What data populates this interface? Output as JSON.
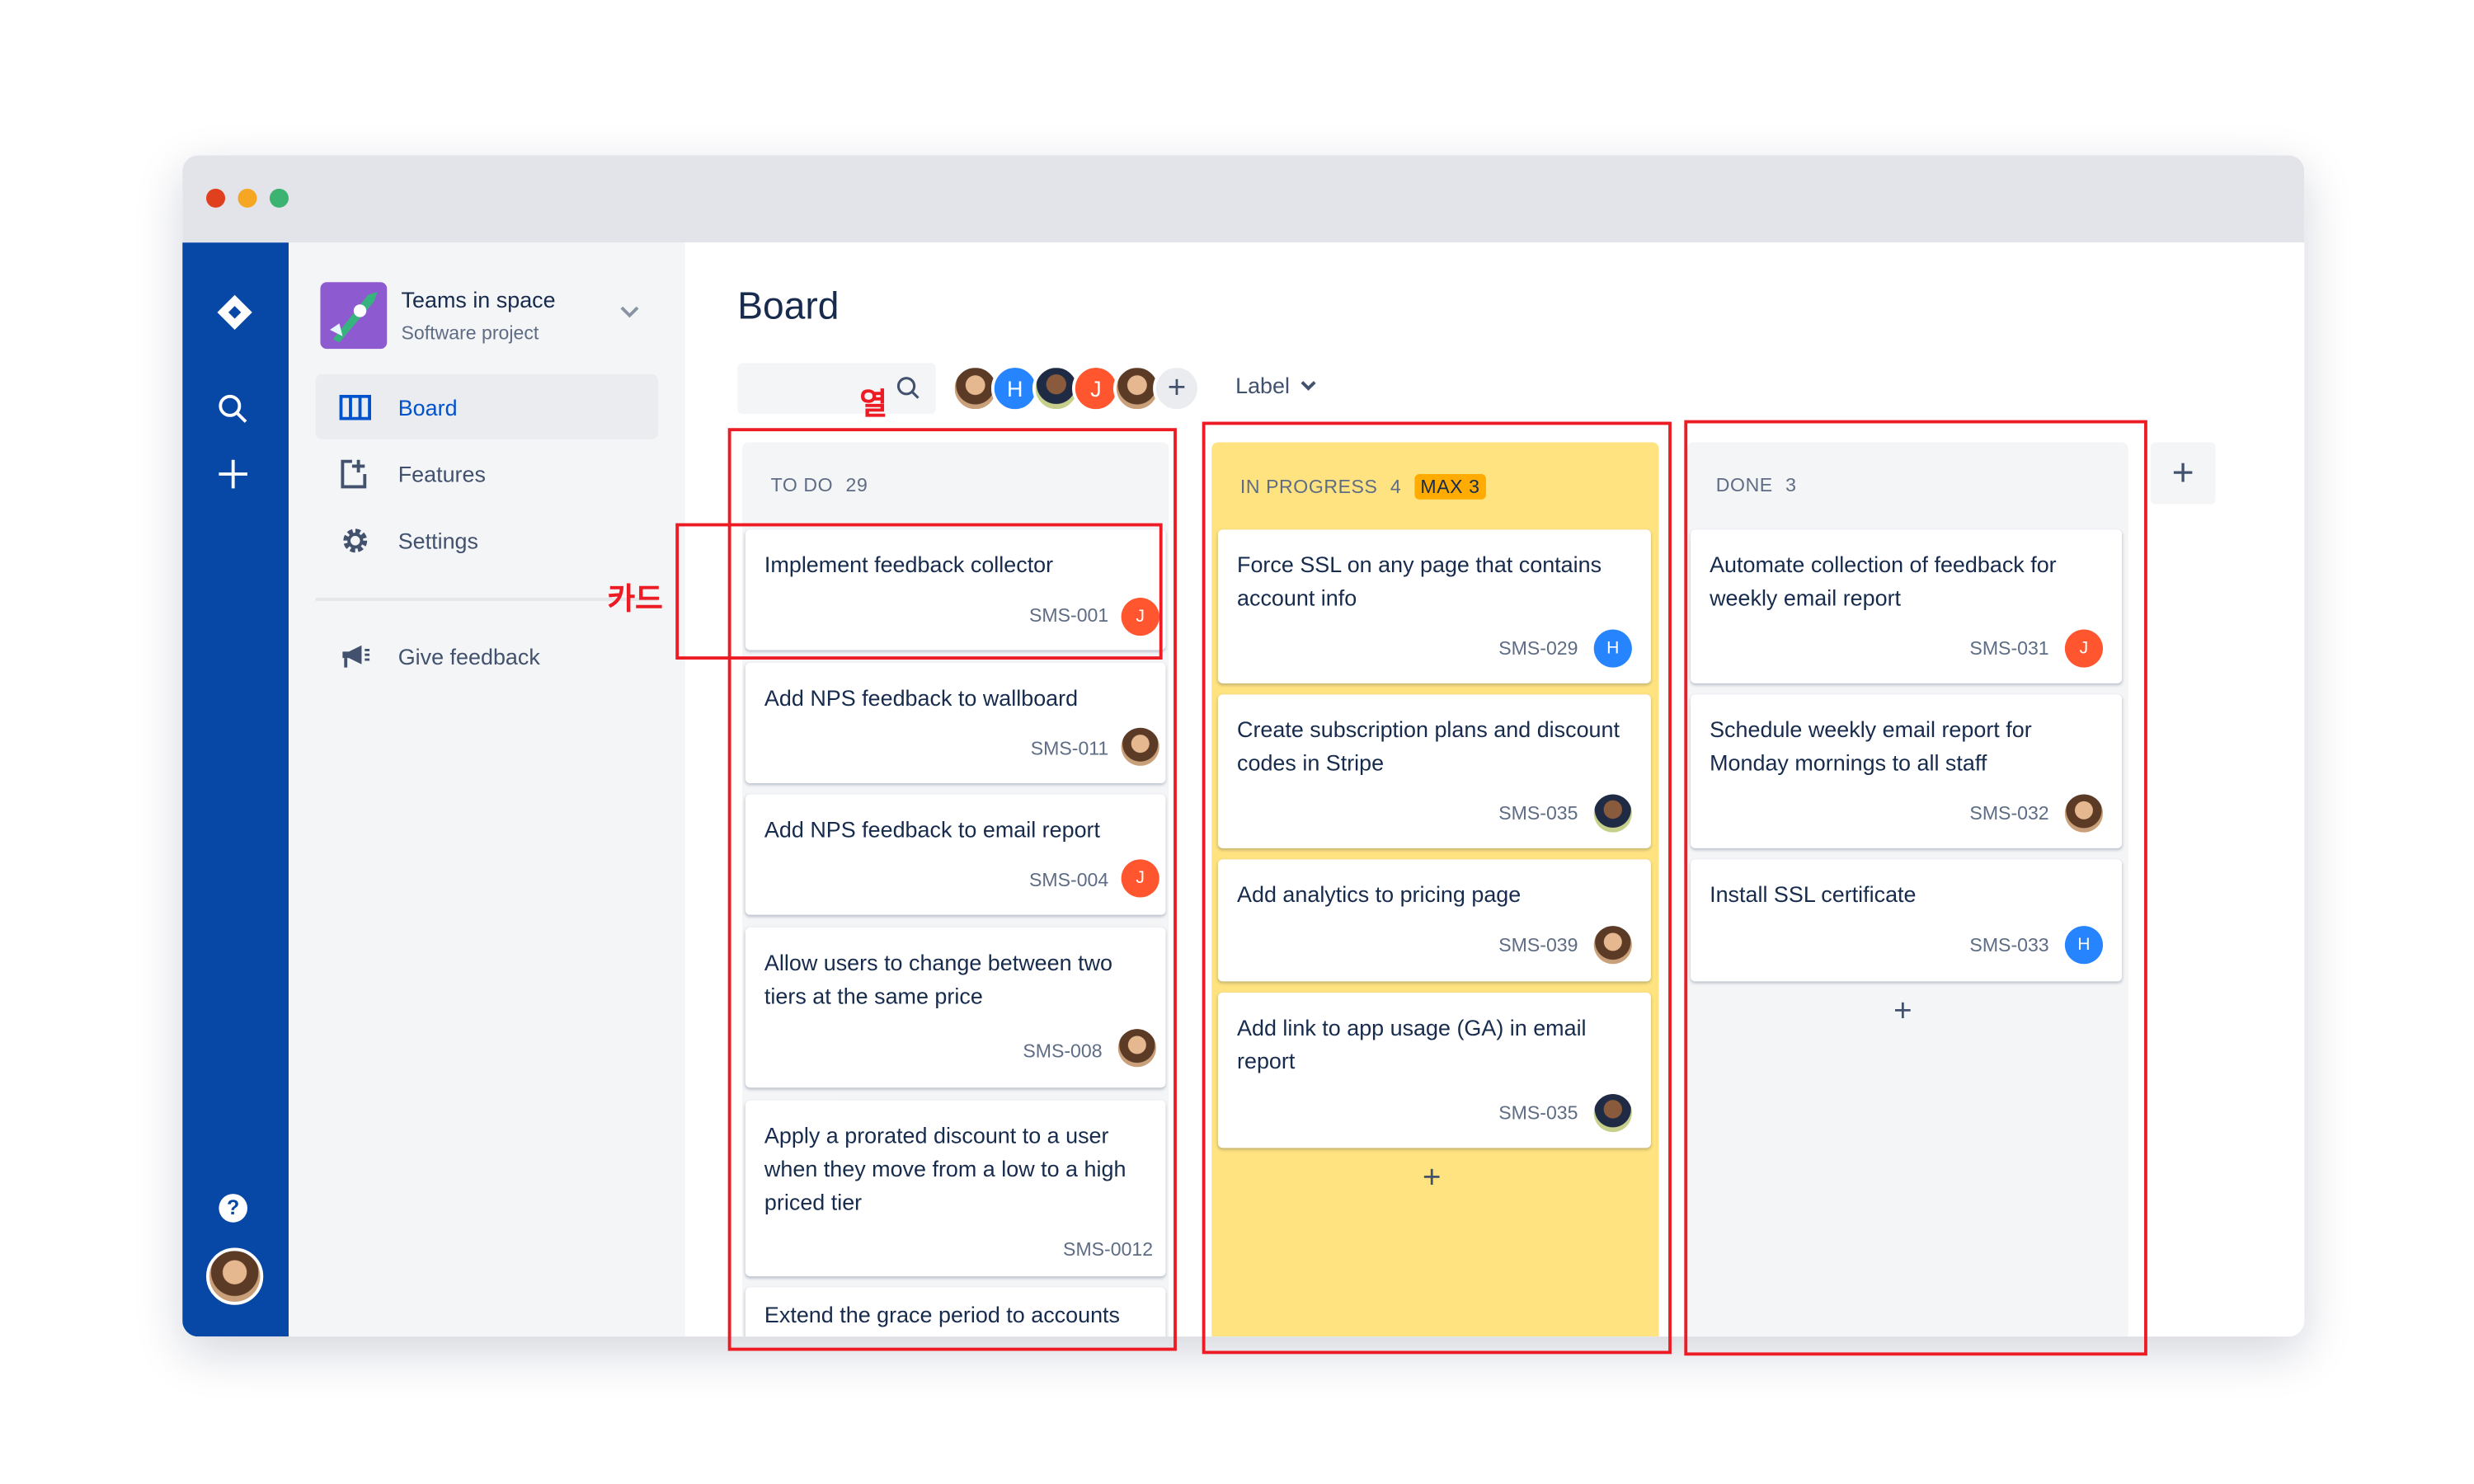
{
  "project": {
    "name": "Teams in space",
    "type": "Software project"
  },
  "sidebar": {
    "items": [
      {
        "label": "Board",
        "icon": "board-icon",
        "active": true
      },
      {
        "label": "Features",
        "icon": "features-icon"
      },
      {
        "label": "Settings",
        "icon": "gear-icon"
      }
    ],
    "feedback": "Give feedback"
  },
  "page": {
    "title": "Board"
  },
  "toolbar": {
    "search_placeholder": "",
    "label_filter": "Label",
    "avatars": [
      {
        "type": "photo"
      },
      {
        "initial": "H",
        "color": "#2684ff"
      },
      {
        "type": "photo"
      },
      {
        "initial": "J",
        "color": "#ff5630"
      },
      {
        "type": "photo"
      }
    ]
  },
  "annotations": {
    "column": "열",
    "card": "카드"
  },
  "columns": [
    {
      "name": "TO DO",
      "count": "29",
      "cards": [
        {
          "title": "Implement feedback collector",
          "key": "SMS-001",
          "assignee": "J"
        },
        {
          "title": "Add NPS feedback to wallboard",
          "key": "SMS-011",
          "assignee": "photo"
        },
        {
          "title": "Add NPS feedback to email report",
          "key": "SMS-004",
          "assignee": "J"
        },
        {
          "title": "Allow users to change between two tiers at the same price",
          "key": "SMS-008",
          "assignee": "photo"
        },
        {
          "title": "Apply a prorated discount to a user when they move from a low to a high priced tier",
          "key": "SMS-0012",
          "assignee": ""
        },
        {
          "title": "Extend the grace period to accounts",
          "key": "",
          "assignee": ""
        }
      ]
    },
    {
      "name": "IN PROGRESS",
      "count": "4",
      "limit": "MAX 3",
      "color": "#ffe380",
      "cards": [
        {
          "title": "Force SSL on any page that contains account info",
          "key": "SMS-029",
          "assignee": "H"
        },
        {
          "title": "Create subscription plans and discount codes in Stripe",
          "key": "SMS-035",
          "assignee": "photo"
        },
        {
          "title": "Add analytics to pricing page",
          "key": "SMS-039",
          "assignee": "photo"
        },
        {
          "title": "Add link to app usage (GA) in email report",
          "key": "SMS-035",
          "assignee": "photo"
        }
      ]
    },
    {
      "name": "DONE",
      "count": "3",
      "cards": [
        {
          "title": "Automate collection of feedback for weekly email report",
          "key": "SMS-031",
          "assignee": "J"
        },
        {
          "title": "Schedule weekly email report for Monday mornings to all staff",
          "key": "SMS-032",
          "assignee": "photo"
        },
        {
          "title": "Install SSL certificate",
          "key": "SMS-033",
          "assignee": "H"
        }
      ]
    }
  ],
  "colors": {
    "rail": "#0747a6",
    "accent": "#0052cc",
    "in_progress": "#ffe380",
    "limit_badge": "#ffab00",
    "annotation": "#ed1c24"
  }
}
